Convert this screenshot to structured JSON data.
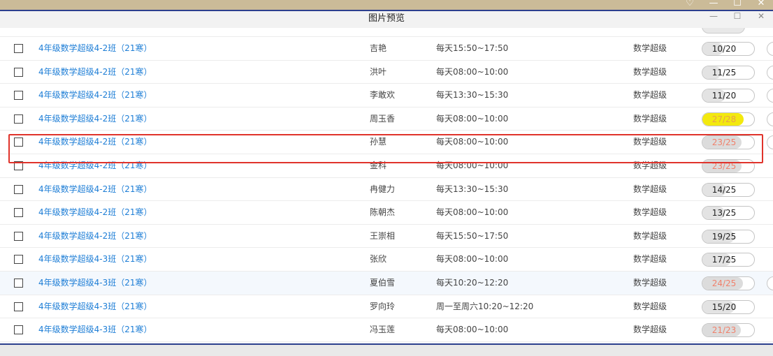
{
  "outer_window": {
    "controls": [
      "♡",
      "—",
      "☐",
      "✕"
    ]
  },
  "dialog": {
    "title": "图片预览",
    "controls": [
      "—",
      "☐",
      "✕"
    ]
  },
  "rows": [
    {
      "class_name": "4年级数学超级4-2班（21寒）",
      "teacher": "吉艳",
      "time": "每天15:50~17:50",
      "subject": "数学超级",
      "capacity": "10/20",
      "enrolled": 10,
      "total": 20,
      "state": "normal",
      "toggle": true
    },
    {
      "class_name": "4年级数学超级4-2班（21寒）",
      "teacher": "洪叶",
      "time": "每天08:00~10:00",
      "subject": "数学超级",
      "capacity": "11/25",
      "enrolled": 11,
      "total": 25,
      "state": "normal",
      "toggle": true
    },
    {
      "class_name": "4年级数学超级4-2班（21寒）",
      "teacher": "李敢欢",
      "time": "每天13:30~15:30",
      "subject": "数学超级",
      "capacity": "11/20",
      "enrolled": 11,
      "total": 20,
      "state": "normal",
      "toggle": true
    },
    {
      "class_name": "4年级数学超级4-2班（21寒）",
      "teacher": "周玉香",
      "time": "每天08:00~10:00",
      "subject": "数学超级",
      "capacity": "27/28",
      "enrolled": 27,
      "total": 28,
      "state": "highlight",
      "toggle": true
    },
    {
      "class_name": "4年级数学超级4-2班（21寒）",
      "teacher": "孙慧",
      "time": "每天08:00~10:00",
      "subject": "数学超级",
      "capacity": "23/25",
      "enrolled": 23,
      "total": 25,
      "state": "warn",
      "toggle": true
    },
    {
      "class_name": "4年级数学超级4-2班（21寒）",
      "teacher": "金科",
      "time": "每天08:00~10:00",
      "subject": "数学超级",
      "capacity": "23/25",
      "enrolled": 23,
      "total": 25,
      "state": "warn",
      "toggle": false
    },
    {
      "class_name": "4年级数学超级4-2班（21寒）",
      "teacher": "冉健力",
      "time": "每天13:30~15:30",
      "subject": "数学超级",
      "capacity": "14/25",
      "enrolled": 14,
      "total": 25,
      "state": "normal",
      "toggle": false
    },
    {
      "class_name": "4年级数学超级4-2班（21寒）",
      "teacher": "陈朝杰",
      "time": "每天08:00~10:00",
      "subject": "数学超级",
      "capacity": "13/25",
      "enrolled": 13,
      "total": 25,
      "state": "normal",
      "toggle": false
    },
    {
      "class_name": "4年级数学超级4-2班（21寒）",
      "teacher": "王崇相",
      "time": "每天15:50~17:50",
      "subject": "数学超级",
      "capacity": "19/25",
      "enrolled": 19,
      "total": 25,
      "state": "normal",
      "toggle": false
    },
    {
      "class_name": "4年级数学超级4-3班（21寒）",
      "teacher": "张欣",
      "time": "每天08:00~10:00",
      "subject": "数学超级",
      "capacity": "17/25",
      "enrolled": 17,
      "total": 25,
      "state": "normal",
      "toggle": false
    },
    {
      "class_name": "4年级数学超级4-3班（21寒）",
      "teacher": "夏伯雪",
      "time": "每天10:20~12:20",
      "subject": "数学超级",
      "capacity": "24/25",
      "enrolled": 24,
      "total": 25,
      "state": "warn",
      "toggle": true,
      "alt": true
    },
    {
      "class_name": "4年级数学超级4-3班（21寒）",
      "teacher": "罗向玲",
      "time": "周一至周六10:20~12:20",
      "subject": "数学超级",
      "capacity": "15/20",
      "enrolled": 15,
      "total": 20,
      "state": "normal",
      "toggle": false
    },
    {
      "class_name": "4年级数学超级4-3班（21寒）",
      "teacher": "冯玉莲",
      "time": "每天08:00~10:00",
      "subject": "数学超级",
      "capacity": "21/23",
      "enrolled": 21,
      "total": 23,
      "state": "warn",
      "toggle": false
    }
  ],
  "colors": {
    "link": "#1e7ed6",
    "highlight_border": "#e0332b",
    "highlight_fill": "#f3e90e",
    "warn_text": "#f0816c",
    "dialog_border": "#2c3f8e"
  }
}
